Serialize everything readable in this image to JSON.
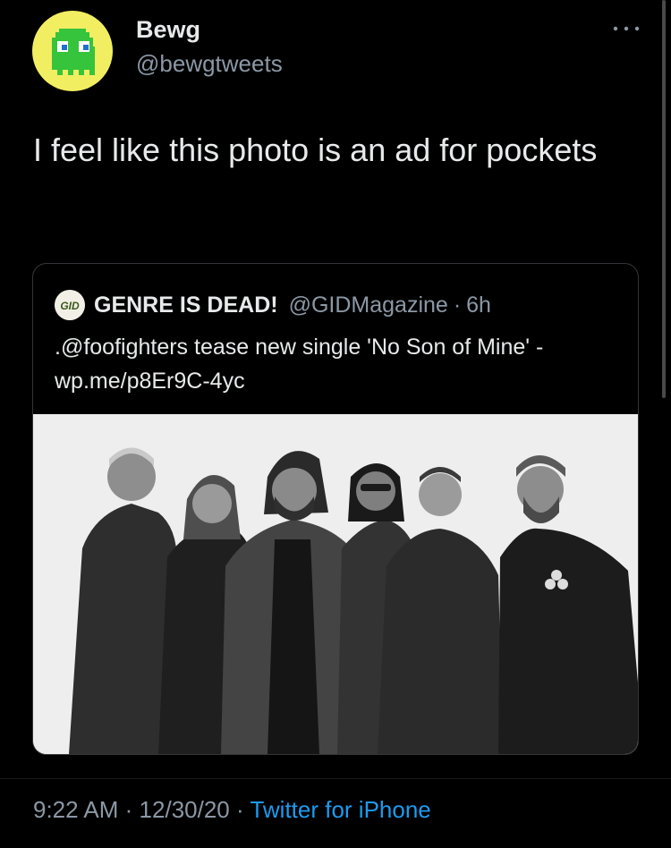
{
  "author": {
    "display_name": "Bewg",
    "handle": "@bewgtweets",
    "avatar_icon": "pixel-ghost-icon",
    "avatar_color": "#f2ee62"
  },
  "more_icon": "more-horizontal-icon",
  "tweet": {
    "text": "I feel like this photo is an ad for pockets"
  },
  "quoted_tweet": {
    "avatar_label": "GID",
    "display_name": "GENRE IS DEAD!",
    "handle": "@GIDMagazine",
    "separator": "·",
    "time": "6h",
    "text": ".@foofighters tease new single 'No Son of Mine' - wp.me/p8Er9C-4yc",
    "media_icon": "band-photo-image"
  },
  "meta": {
    "time": "9:22 AM",
    "date": "12/30/20",
    "separator": "·",
    "source": "Twitter for iPhone"
  },
  "colors": {
    "background": "#000000",
    "text": "#e7e9ea",
    "secondary_text": "#8b98a5",
    "link": "#1d9bf0"
  }
}
